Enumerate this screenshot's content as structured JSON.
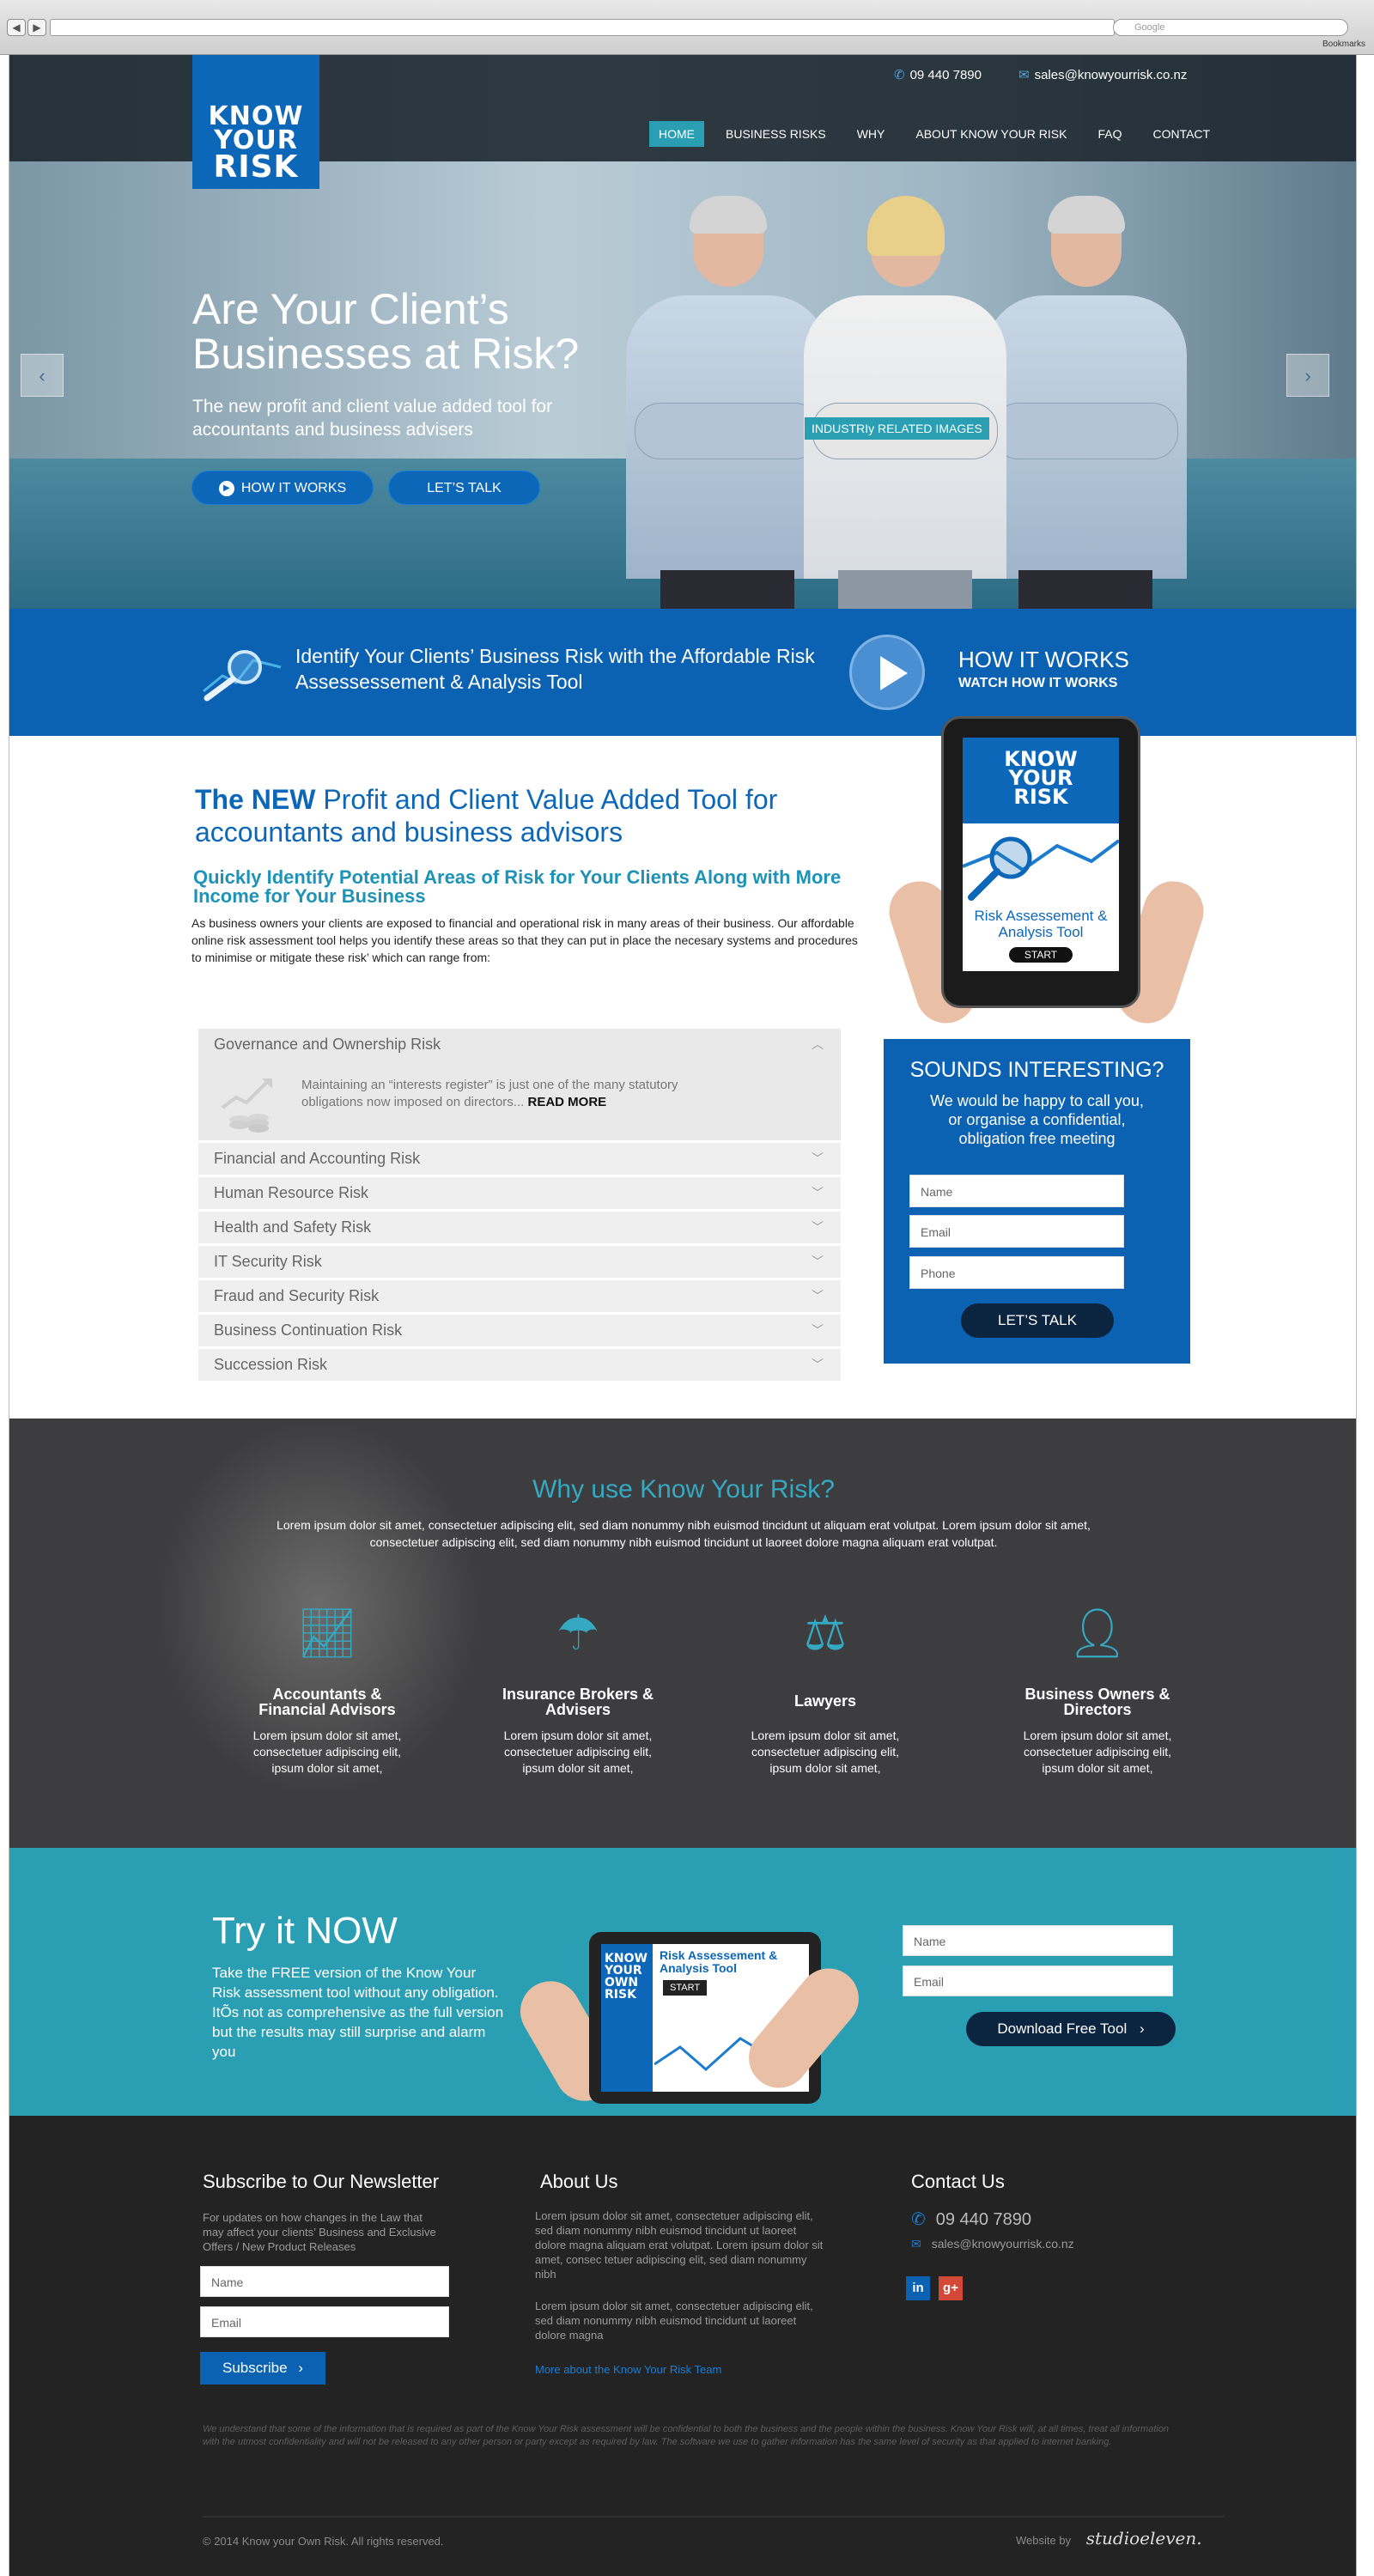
{
  "browser": {
    "back_label": "◀",
    "forward_label": "▶",
    "search_placeholder": "Google",
    "bookmarks_label": "Bookmarks"
  },
  "header": {
    "logo_lines": [
      "KNOW",
      "YOUR",
      "RISK"
    ],
    "phone": "09 440 7890",
    "email": "sales@knowyourrisk.co.nz",
    "nav": [
      "HOME",
      "BUSINESS RISKS",
      "WHY",
      "ABOUT KNOW YOUR RISK",
      "FAQ",
      "CONTACT"
    ],
    "active_nav": "HOME"
  },
  "hero": {
    "title_line1": "Are Your Client’s",
    "title_line2": "Businesses at Risk?",
    "subtitle": "The new profit and client value added tool for accountants and business advisers",
    "btn_how": "HOW IT WORKS",
    "btn_talk": "LET’S TALK",
    "image_label": "INDUSTRIy RELATED IMAGES",
    "prev_icon": "chevron-left-icon",
    "next_icon": "chevron-right-icon"
  },
  "band": {
    "text": "Identify Your Clients’ Business Risk with the Affordable Risk Assessessement & Analysis Tool",
    "how_title": "HOW IT WORKS",
    "how_sub": "WATCH HOW IT WORKS"
  },
  "content": {
    "h1_prefix": "The NEW",
    "h1_rest": " Profit and Client Value Added Tool for accountants and business advisors",
    "h2": "Quickly Identify Potential Areas of Risk for Your Clients Along with More Income for Your Business",
    "intro": "As business owners your clients are exposed to financial and operational risk in many areas of their business. Our affordable online risk assessment tool helps you identify these areas so that they can put in place the necesary systems and procedures to minimise or mitigate these risk’ which can range from:"
  },
  "accordion": {
    "open_title": "Governance and Ownership Risk",
    "open_body": "Maintaining an “interests register” is just one of the  many statutory obligations now imposed on directors...",
    "read_more": "READ MORE",
    "items": [
      "Financial and Accounting Risk",
      "Human Resource Risk",
      "Health and Safety Risk",
      "IT Security Risk",
      "Fraud and Security Risk",
      "Business Continuation Risk",
      "Succession Risk"
    ]
  },
  "tablet": {
    "logo_lines": [
      "KNOW",
      "YOUR",
      "RISK"
    ],
    "label": "Risk Assessement & Analysis Tool",
    "start": "START"
  },
  "sidebar_form": {
    "title": "SOUNDS INTERESTING?",
    "subtitle": "We would be happy to call you, or organise a confidential, obligation free meeting",
    "name_placeholder": "Name",
    "email_placeholder": "Email",
    "phone_placeholder": "Phone",
    "button": "LET’S TALK"
  },
  "why": {
    "title": "Why use Know Your Risk?",
    "text": "Lorem ipsum dolor sit amet, consectetuer adipiscing elit, sed diam nonummy nibh euismod tincidunt ut aliquam erat volutpat. Lorem ipsum dolor sit amet, consectetuer adipiscing elit, sed diam nonummy nibh euismod tincidunt ut laoreet dolore magna aliquam erat volutpat.",
    "features": [
      {
        "icon": "growth-chart-icon",
        "title": "Accountants & Financial Advisors",
        "desc": "Lorem ipsum dolor sit amet, consectetuer adipiscing elit, ipsum dolor sit amet,"
      },
      {
        "icon": "umbrella-icon",
        "title": "Insurance Brokers & Advisers",
        "desc": "Lorem ipsum dolor sit amet, consectetuer adipiscing elit, ipsum dolor sit amet,"
      },
      {
        "icon": "scales-icon",
        "title": "Lawyers",
        "desc": "Lorem ipsum dolor sit amet, consectetuer adipiscing elit, ipsum dolor sit amet,"
      },
      {
        "icon": "business-person-icon",
        "title": "Business Owners & Directors",
        "desc": "Lorem ipsum dolor sit amet, consectetuer adipiscing elit, ipsum dolor sit amet,"
      }
    ]
  },
  "try": {
    "title": "Try it NOW",
    "text": "Take the FREE version of the Know Your Risk assessment tool without any obligation.  ItÕs not as comprehensive as the full version but the results may still surprise and alarm you",
    "tablet_logo": [
      "KNOW",
      "YOUR",
      "OWN",
      "RISK"
    ],
    "tablet_title": "Risk Assessement & Analysis Tool",
    "tablet_start": "START",
    "name_placeholder": "Name",
    "email_placeholder": "Email",
    "button": "Download Free Tool"
  },
  "footer": {
    "newsletter_title": "Subscribe to Our Newsletter",
    "newsletter_text": "For updates on how changes in the Law that may affect your clients’ Business and Exclusive Offers / New Product Releases",
    "name_placeholder": "Name",
    "email_placeholder": "Email",
    "subscribe": "Subscribe",
    "about_title": "About Us",
    "about_p1": "Lorem ipsum dolor sit amet, consectetuer adipiscing elit, sed diam nonummy nibh euismod tincidunt ut laoreet dolore magna aliquam erat volutpat. Lorem ipsum dolor sit amet, consec tetuer adipiscing elit, sed diam nonummy nibh",
    "about_p2": "Lorem ipsum dolor sit amet, consectetuer adipiscing elit, sed diam nonummy nibh euismod tincidunt ut laoreet dolore magna",
    "about_link": "More about the Know Your Risk Team",
    "contact_title": "Contact Us",
    "phone": "09 440 7890",
    "email": "sales@knowyourrisk.co.nz",
    "linkedin": "in",
    "gplus": "g+",
    "disclaimer": "We understand that some of the information that is required as part of the Know Your Risk  assessment will be confidential to both the business and the people within the business.  Know Your Risk will, at all times, treat all information with the utmost confidentiality and will not be  released to any other person or party except as required by law.  The  software we use to gather  information has the same level of security as that applied to internet banking.",
    "copyright": "© 2014  Know your Own Risk. All rights reserved.",
    "credit_label": "Website by",
    "credit_name": "studioeleven."
  },
  "colors": {
    "brand_blue": "#0b62b3",
    "teal": "#2a9fb4",
    "dark": "#232323"
  }
}
